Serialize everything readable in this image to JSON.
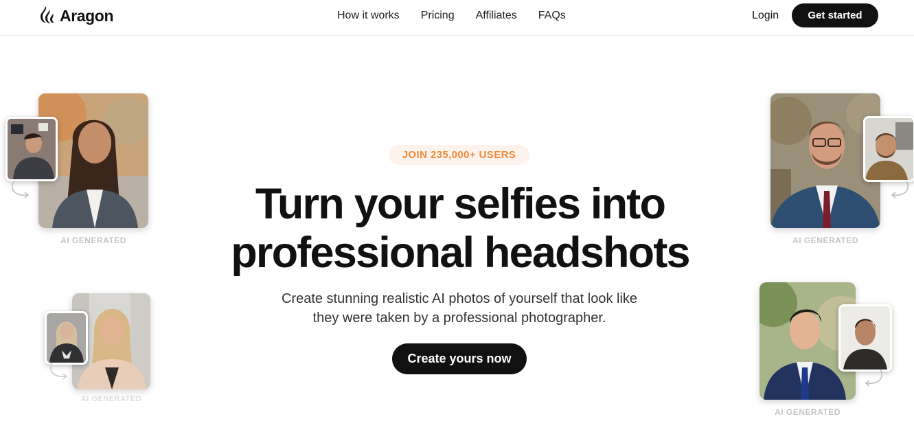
{
  "header": {
    "brand": "Aragon",
    "nav": [
      "How it works",
      "Pricing",
      "Affiliates",
      "FAQs"
    ],
    "login_label": "Login",
    "cta_label": "Get started"
  },
  "hero": {
    "badge": "JOIN 235,000+ USERS",
    "title_line1": "Turn your selfies into",
    "title_line2": "professional headshots",
    "subtitle_line1": "Create stunning realistic AI photos of yourself that look like",
    "subtitle_line2": "they were taken by a professional photographer.",
    "cta_label": "Create yours now"
  },
  "examples": [
    {
      "label": "AI GENERATED"
    },
    {
      "label": "AI GENERATED"
    },
    {
      "label": "AI GENERATED"
    },
    {
      "label": "AI GENERATED"
    }
  ],
  "colors": {
    "accent_orange": "#f08a3c",
    "badge_bg": "#fdf3ec",
    "button_bg": "#111111"
  }
}
